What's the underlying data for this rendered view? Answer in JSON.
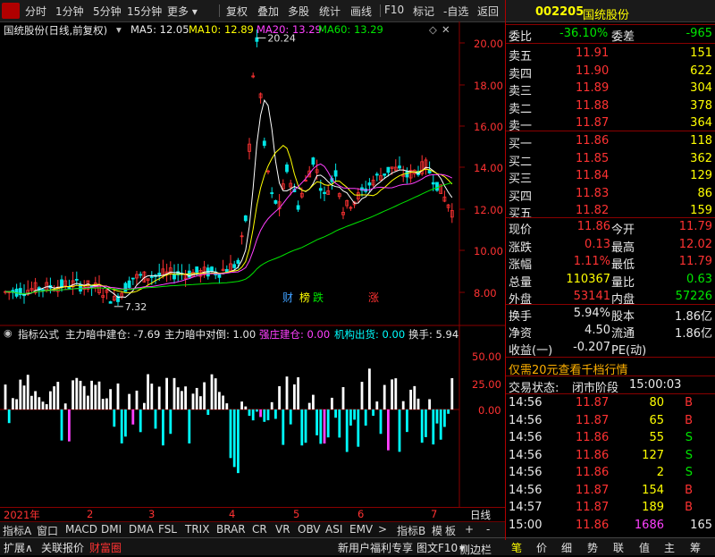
{
  "toolbar": {
    "items": [
      "分时",
      "1分钟",
      "5分钟",
      "15分钟",
      "更多",
      "复权",
      "叠加",
      "多股",
      "统计",
      "画线",
      "F10",
      "标记",
      "-自选",
      "返回"
    ]
  },
  "chart_header": {
    "name": "国统股份(日线,前复权)",
    "ma5": "MA5: 12.05",
    "ma10": "MA10: 12.89",
    "ma20": "MA20: 13.29",
    "ma60": "MA60: 13.29"
  },
  "price_axis": [
    "20.00",
    "18.00",
    "16.00",
    "14.00",
    "12.00",
    "10.00",
    "8.00"
  ],
  "high_label": "20.24",
  "low_label": "7.32",
  "event_marks": [
    "财",
    "榜",
    "跌",
    "涨"
  ],
  "indicator_header": {
    "title": "指标公式",
    "build": "主力暗中建仓: -7.69",
    "dump": "主力暗中对倒: 1.00",
    "strong": "强庄建仓: 0.00",
    "inst": "机构出货: 0.00",
    "turnover": "换手: 5.94"
  },
  "indicator_axis": [
    "50.00",
    "25.00",
    "0.00"
  ],
  "time_axis": [
    "2021年",
    "2",
    "3",
    "4",
    "5",
    "6",
    "7"
  ],
  "bottom_tabs": [
    "指标A",
    "窗口",
    "MACD",
    "DMI",
    "DMA",
    "FSL",
    "TRIX",
    "BRAR",
    "CR",
    "VR",
    "OBV",
    "ASI",
    "EMV",
    ">",
    "指标B",
    "模",
    "板",
    "+",
    "-"
  ],
  "period_label": "日线",
  "status_bar": {
    "left": [
      "扩展∧",
      "关联报价",
      "财富圈"
    ],
    "promo": "新用户福利专享",
    "f10": "图文F10",
    "sidebar": "侧边栏",
    "tabs": [
      "笔",
      "价",
      "细",
      "势",
      "联",
      "值",
      "主",
      "筹"
    ]
  },
  "quote": {
    "code": "002205",
    "name": "国统股份",
    "weibi_label": "委比",
    "weibi": "-36.10%",
    "weicha_label": "委差",
    "weicha": "-965",
    "asks": [
      {
        "label": "卖五",
        "price": "11.91",
        "vol": "151"
      },
      {
        "label": "卖四",
        "price": "11.90",
        "vol": "622"
      },
      {
        "label": "卖三",
        "price": "11.89",
        "vol": "304"
      },
      {
        "label": "卖二",
        "price": "11.88",
        "vol": "378"
      },
      {
        "label": "卖一",
        "price": "11.87",
        "vol": "364"
      }
    ],
    "bids": [
      {
        "label": "买一",
        "price": "11.86",
        "vol": "118"
      },
      {
        "label": "买二",
        "price": "11.85",
        "vol": "362"
      },
      {
        "label": "买三",
        "price": "11.84",
        "vol": "129"
      },
      {
        "label": "买四",
        "price": "11.83",
        "vol": "86"
      },
      {
        "label": "买五",
        "price": "11.82",
        "vol": "159"
      }
    ],
    "stats": [
      {
        "l1": "现价",
        "v1": "11.86",
        "l2": "今开",
        "v2": "11.79"
      },
      {
        "l1": "涨跌",
        "v1": "0.13",
        "l2": "最高",
        "v2": "12.02"
      },
      {
        "l1": "涨幅",
        "v1": "1.11%",
        "l2": "最低",
        "v2": "11.79"
      },
      {
        "l1": "总量",
        "v1": "110367",
        "l2": "量比",
        "v2": "0.63"
      },
      {
        "l1": "外盘",
        "v1": "53141",
        "l2": "内盘",
        "v2": "57226"
      }
    ],
    "stats2": [
      {
        "l1": "换手",
        "v1": "5.94%",
        "l2": "股本",
        "v2": "1.86亿"
      },
      {
        "l1": "净资",
        "v1": "4.50",
        "l2": "流通",
        "v2": "1.86亿"
      },
      {
        "l1": "收益(一)",
        "v1": "-0.207",
        "l2": "PE(动)",
        "v2": ""
      }
    ],
    "promo": "仅需20元查看千档行情",
    "trade_status_label": "交易状态:",
    "trade_status": "闭市阶段",
    "trade_time": "15:00:03",
    "ticks": [
      {
        "t": "14:56",
        "p": "11.87",
        "v": "80",
        "d": "B"
      },
      {
        "t": "14:56",
        "p": "11.87",
        "v": "65",
        "d": "B"
      },
      {
        "t": "14:56",
        "p": "11.86",
        "v": "55",
        "d": "S"
      },
      {
        "t": "14:56",
        "p": "11.86",
        "v": "127",
        "d": "S"
      },
      {
        "t": "14:56",
        "p": "11.86",
        "v": "2",
        "d": "S"
      },
      {
        "t": "14:56",
        "p": "11.87",
        "v": "154",
        "d": "B"
      },
      {
        "t": "14:57",
        "p": "11.87",
        "v": "189",
        "d": "B"
      },
      {
        "t": "15:00",
        "p": "11.86",
        "v": "1686",
        "d": "165"
      }
    ]
  },
  "colors": {
    "up": "#ff3232",
    "down": "#00e600",
    "ma5": "#ffffff",
    "ma10": "#ffff00",
    "ma20": "#ff40ff",
    "ma60": "#00e600",
    "grid": "#8a0000"
  }
}
